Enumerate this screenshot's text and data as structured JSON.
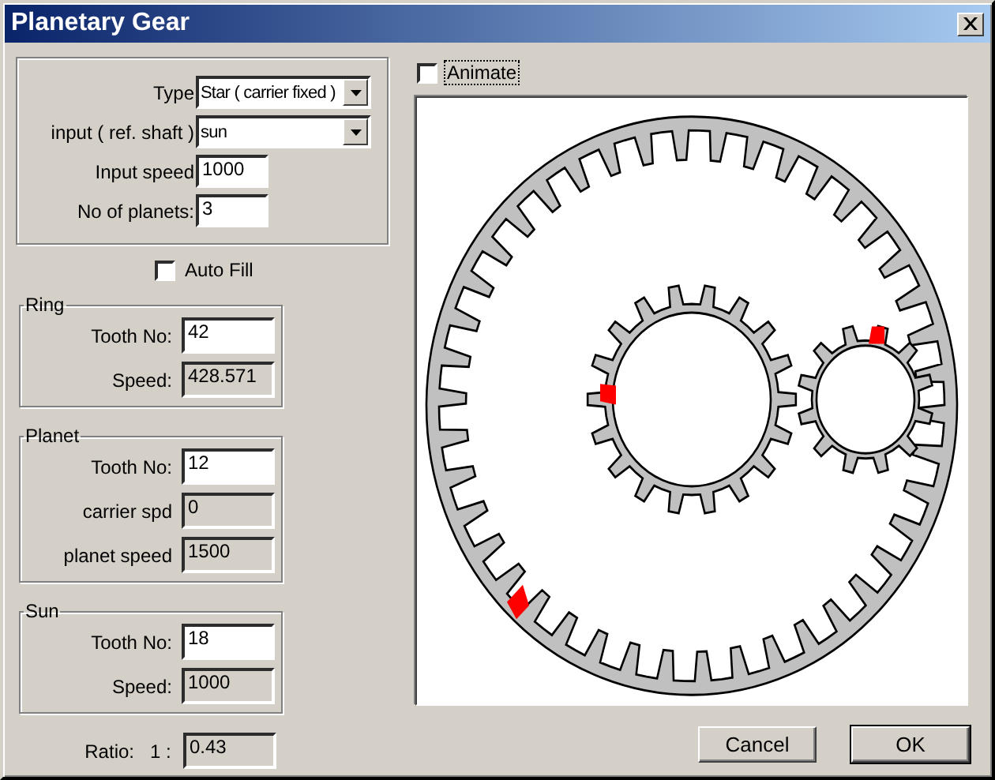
{
  "window": {
    "title": "Planetary Gear"
  },
  "config": {
    "type": {
      "label": "Type",
      "value": "Star ( carrier fixed )"
    },
    "input": {
      "label": "input ( ref. shaft )",
      "value": "sun"
    },
    "input_speed": {
      "label": "Input speed",
      "value": "1000"
    },
    "planets": {
      "label": "No of planets:",
      "value": "3"
    }
  },
  "auto_fill": {
    "label": "Auto Fill",
    "checked": false
  },
  "groups": [
    {
      "title": "Ring",
      "fields": [
        {
          "label": "Tooth No:",
          "value": "42",
          "kind": "edit"
        },
        {
          "label": "Speed:",
          "value": "428.571",
          "kind": "readonly"
        }
      ]
    },
    {
      "title": "Planet",
      "fields": [
        {
          "label": "Tooth No:",
          "value": "12",
          "kind": "edit"
        },
        {
          "label": "carrier spd",
          "value": "0",
          "kind": "readonly"
        },
        {
          "label": "planet speed",
          "value": "1500",
          "kind": "readonly"
        }
      ]
    },
    {
      "title": "Sun",
      "fields": [
        {
          "label": "Tooth No:",
          "value": "18",
          "kind": "edit"
        },
        {
          "label": "Speed:",
          "value": "1000",
          "kind": "readonly"
        }
      ]
    }
  ],
  "ratio": {
    "label": "Ratio:",
    "prefix": "1 :",
    "value": "0.43"
  },
  "animate": {
    "label": "Animate",
    "checked": false,
    "focused": true
  },
  "buttons": [
    {
      "label": "Cancel",
      "default": false
    },
    {
      "label": "OK",
      "default": true
    }
  ]
}
